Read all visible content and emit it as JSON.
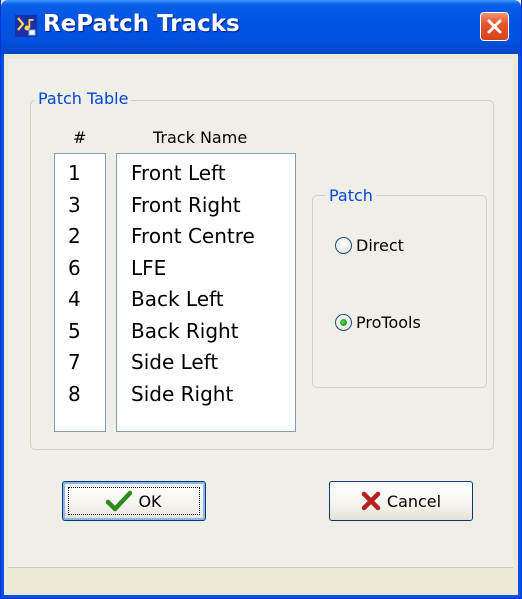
{
  "window": {
    "title": "RePatch Tracks",
    "colors": {
      "titlebar": "#0054e3",
      "accent": "#0046d5",
      "close": "#e3562e"
    }
  },
  "patch_table": {
    "label": "Patch Table",
    "col_num": "#",
    "col_name": "Track Name",
    "rows": [
      {
        "num": "1",
        "name": "Front Left"
      },
      {
        "num": "3",
        "name": "Front Right"
      },
      {
        "num": "2",
        "name": "Front Centre"
      },
      {
        "num": "6",
        "name": "LFE"
      },
      {
        "num": "4",
        "name": "Back Left"
      },
      {
        "num": "5",
        "name": "Back Right"
      },
      {
        "num": "7",
        "name": "Side Left"
      },
      {
        "num": "8",
        "name": "Side Right"
      }
    ]
  },
  "patch": {
    "label": "Patch",
    "options": [
      {
        "label": "Direct",
        "selected": false
      },
      {
        "label": "ProTools",
        "selected": true
      }
    ]
  },
  "buttons": {
    "ok": "OK",
    "cancel": "Cancel"
  },
  "icons": {
    "app": "app-icon",
    "close": "close-icon",
    "ok": "checkmark-icon",
    "cancel": "x-icon"
  }
}
